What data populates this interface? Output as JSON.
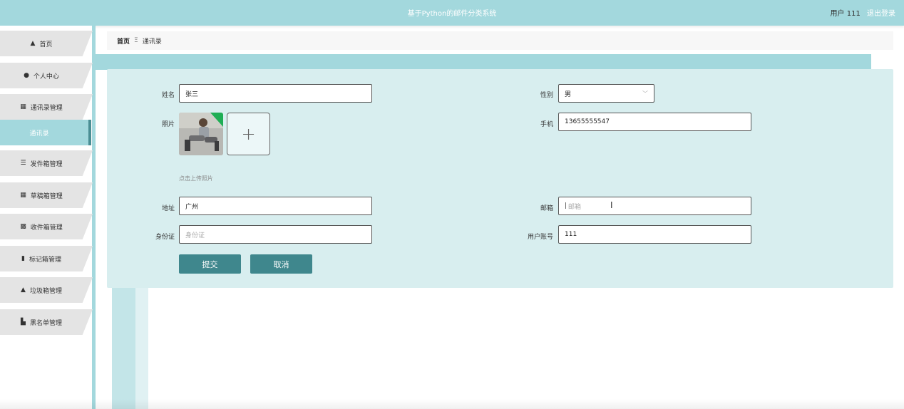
{
  "header": {
    "title": "基于Python的邮件分类系统",
    "user_text": "用户 111",
    "logout": "退出登录"
  },
  "sidebar": {
    "items": [
      {
        "label": "首页",
        "icon": "home-icon"
      },
      {
        "label": "个人中心",
        "icon": "user-icon"
      },
      {
        "label": "通讯录管理",
        "icon": "grid-icon"
      },
      {
        "label": "通讯录",
        "icon": "",
        "active": true
      },
      {
        "label": "发件箱管理",
        "icon": "list-icon"
      },
      {
        "label": "草稿箱管理",
        "icon": "grid-icon"
      },
      {
        "label": "收件箱管理",
        "icon": "table-icon"
      },
      {
        "label": "标记箱管理",
        "icon": "bar-chart-icon"
      },
      {
        "label": "垃圾箱管理",
        "icon": "trash-icon"
      },
      {
        "label": "黑名单管理",
        "icon": "book-icon"
      }
    ]
  },
  "breadcrumb": {
    "home": "首页",
    "separator": "Ξ",
    "current": "通讯录"
  },
  "form": {
    "name_label": "姓名",
    "name_value": "张三",
    "gender_label": "性别",
    "gender_value": "男",
    "photo_label": "照片",
    "upload_plus": "+",
    "upload_hint": "点击上传照片",
    "phone_label": "手机",
    "phone_value": "13655555547",
    "address_label": "地址",
    "address_value": "广州",
    "email_label": "邮箱",
    "email_placeholder": "邮箱",
    "idcard_label": "身份证",
    "idcard_placeholder": "身份证",
    "account_label": "用户账号",
    "account_value": "111",
    "submit": "提交",
    "cancel": "取消"
  },
  "colors": {
    "primary": "#a3d8dd",
    "button": "#3f878d",
    "panel": "#d8eeef"
  }
}
